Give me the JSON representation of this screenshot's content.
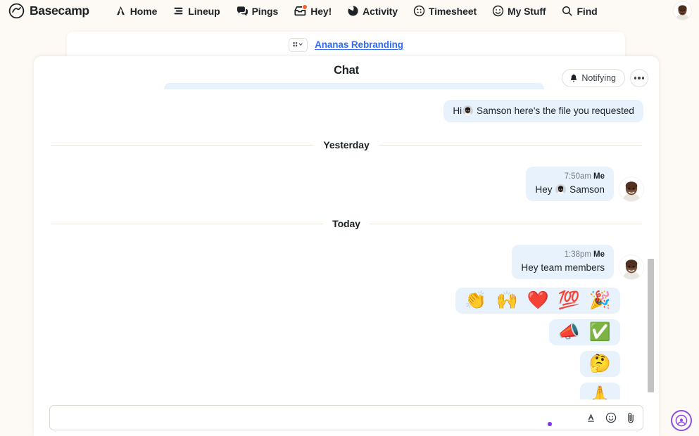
{
  "app": {
    "brand": "Basecamp",
    "background_color": "#fdf9f4",
    "accent_color": "#2f6df6",
    "badge_color": "#f4622f"
  },
  "topnav": {
    "items": [
      {
        "label": "Home",
        "icon": "home-icon"
      },
      {
        "label": "Lineup",
        "icon": "lineup-icon"
      },
      {
        "label": "Pings",
        "icon": "pings-icon"
      },
      {
        "label": "Hey!",
        "icon": "hey-icon",
        "badge": true
      },
      {
        "label": "Activity",
        "icon": "activity-icon"
      },
      {
        "label": "Timesheet",
        "icon": "timesheet-icon"
      },
      {
        "label": "My Stuff",
        "icon": "my-stuff-icon"
      },
      {
        "label": "Find",
        "icon": "search-icon"
      }
    ],
    "avatar_name": "account-avatar"
  },
  "breadcrumb": {
    "grid_icon": "grid-chevron-icon",
    "project": "Ananas Rebranding"
  },
  "chat": {
    "title": "Chat",
    "notifying_label": "Notifying",
    "notifying_icon": "bell-icon",
    "more_label": "More options",
    "messages": [
      {
        "type": "text",
        "text_before": "Hi",
        "mention_avatar": "mention-avatar",
        "text_after": "Samson here's the file you requested",
        "has_meta": false,
        "has_avatar": false
      },
      {
        "type": "divider",
        "label": "Yesterday"
      },
      {
        "type": "text",
        "time": "7:50am",
        "author": "Me",
        "text_before": "Hey",
        "mention_avatar": "mention-avatar",
        "text_after": "Samson",
        "has_meta": true,
        "has_avatar": true
      },
      {
        "type": "divider",
        "label": "Today"
      },
      {
        "type": "text",
        "time": "1:38pm",
        "author": "Me",
        "text_before": "Hey team members",
        "has_meta": true,
        "has_avatar": false
      },
      {
        "type": "emoji",
        "emojis": [
          "👏",
          "🙌",
          "❤️",
          "💯",
          "🎉"
        ]
      },
      {
        "type": "emoji",
        "emojis": [
          "📣",
          "✅"
        ]
      },
      {
        "type": "emoji",
        "emojis": [
          "🤔"
        ]
      },
      {
        "type": "emoji",
        "emojis": [
          "🙏"
        ]
      }
    ]
  },
  "composer": {
    "placeholder": "",
    "value": "",
    "tools": [
      {
        "name": "text-format-icon",
        "label": "A"
      },
      {
        "name": "emoji-icon",
        "label": "Emoji"
      },
      {
        "name": "attachment-icon",
        "label": "Attach file"
      }
    ]
  },
  "help_widget": {
    "name": "help-widget",
    "color": "#8b4de8"
  }
}
